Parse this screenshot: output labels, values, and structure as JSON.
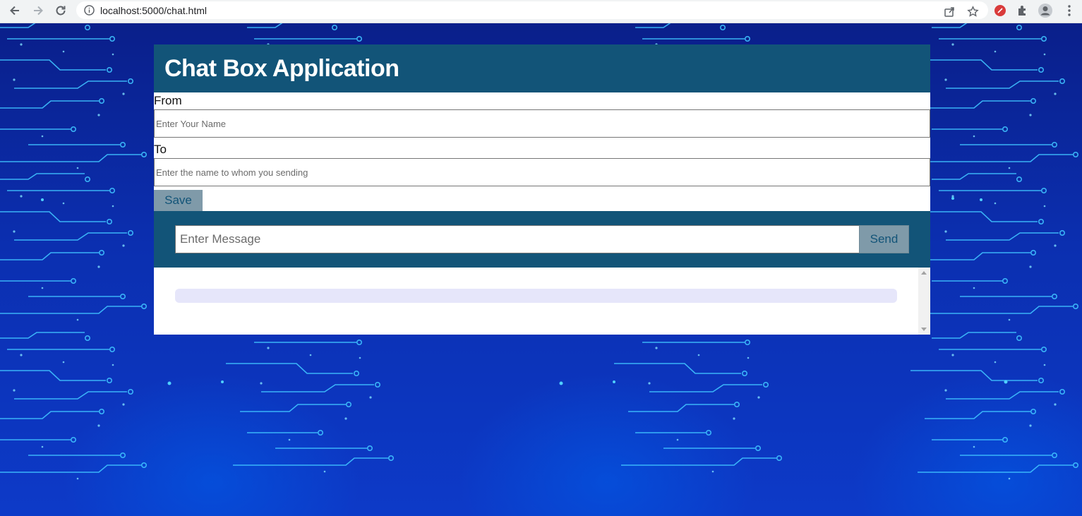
{
  "browser": {
    "url": "localhost:5000/chat.html"
  },
  "app": {
    "title": "Chat Box Application",
    "from_label": "From",
    "from_placeholder": "Enter Your Name",
    "to_label": "To",
    "to_placeholder": "Enter the name to whom you sending",
    "save_label": "Save",
    "message_placeholder": "Enter Message",
    "send_label": "Send"
  },
  "colors": {
    "header": "#125478",
    "button": "#7f9aa9",
    "message_bubble": "#e6e6fa"
  }
}
